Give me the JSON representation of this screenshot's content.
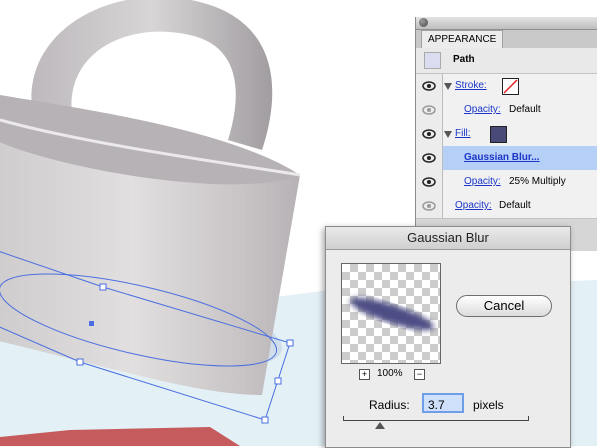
{
  "appearance_panel": {
    "tab_label": "APPEARANCE",
    "path_label": "Path",
    "rows": [
      {
        "label": "Stroke:",
        "type": "stroke"
      },
      {
        "label": "Opacity:",
        "value": "Default"
      },
      {
        "label": "Fill:",
        "type": "fill"
      },
      {
        "label": "Gaussian Blur...",
        "selected": true
      },
      {
        "label": "Opacity:",
        "value": "25% Multiply"
      },
      {
        "label": "Opacity:",
        "value": "Default"
      }
    ],
    "colors": {
      "fill_swatch": "#4a4a78",
      "selected_row": "#b6cff7",
      "link": "#1a36c8"
    }
  },
  "gaussian_blur_dialog": {
    "title": "Gaussian Blur",
    "cancel_label": "Cancel",
    "zoom_level": "100%",
    "zoom_in_label": "+",
    "zoom_out_label": "−",
    "radius_label": "Radius:",
    "radius_value": "3.7",
    "unit_label": "pixels"
  }
}
